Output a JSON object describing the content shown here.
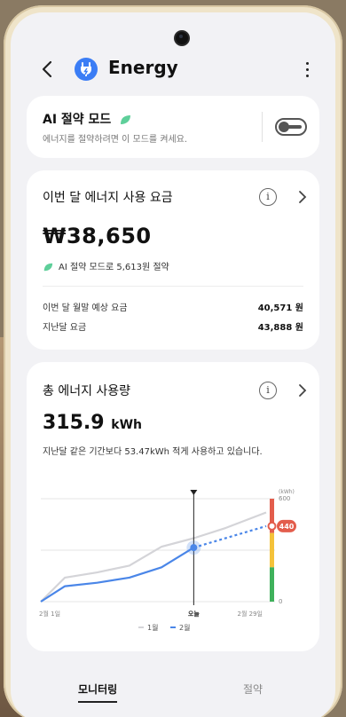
{
  "header": {
    "title": "Energy",
    "app_icon": "energy-plug-icon",
    "back_icon": "chevron-left-icon",
    "more_icon": "more-vertical-icon"
  },
  "ai_mode": {
    "title": "AI 절약 모드",
    "subtitle": "에너지를 절약하려면 이 모드를 켜세요.",
    "enabled": false
  },
  "bill": {
    "title": "이번 달 에너지 사용 요금",
    "amount": "₩38,650",
    "saving_text": "AI 절약 모드로 5,613원 절약",
    "rows": [
      {
        "label": "이번 달 월말 예상 요금",
        "value": "40,571 원"
      },
      {
        "label": "지난달 요금",
        "value": "43,888 원"
      }
    ]
  },
  "usage": {
    "title": "총 에너지 사용량",
    "value": "315.9",
    "unit": "kWh",
    "description": "지난달 같은 기간보다 53.47kWh 적게 사용하고 있습니다."
  },
  "chart_data": {
    "type": "line",
    "y_unit": "(kWh)",
    "y_ticks": [
      "600",
      "0"
    ],
    "x_ticks": [
      "2월 1일",
      "오늘",
      "2월 29일"
    ],
    "today_marker": "오늘",
    "forecast_label": "440",
    "ylim": [
      0,
      600
    ],
    "legend": [
      "1월",
      "2월"
    ],
    "series": [
      {
        "name": "1월",
        "color": "#d4d4d8",
        "points": [
          [
            1,
            0
          ],
          [
            4,
            140
          ],
          [
            8,
            170
          ],
          [
            12,
            210
          ],
          [
            16,
            320
          ],
          [
            20,
            370
          ],
          [
            24,
            430
          ],
          [
            29,
            520
          ]
        ]
      },
      {
        "name": "2월",
        "color": "#4a86e8",
        "points": [
          [
            1,
            0
          ],
          [
            4,
            90
          ],
          [
            8,
            110
          ],
          [
            12,
            140
          ],
          [
            16,
            200
          ],
          [
            20,
            315
          ]
        ]
      },
      {
        "name": "2월 예상",
        "color": "#4a86e8",
        "dashed": true,
        "points": [
          [
            20,
            315
          ],
          [
            29,
            440
          ]
        ]
      }
    ],
    "today_day": 20,
    "x_range": [
      1,
      29
    ],
    "gauge_colors": [
      "#e35d4c",
      "#f4c23a",
      "#3fb15b"
    ]
  },
  "bottom_nav": {
    "tabs": [
      {
        "label": "모니터링",
        "active": true
      },
      {
        "label": "절약",
        "active": false
      }
    ]
  },
  "colors": {
    "accent": "#3b7df5",
    "leaf": "#5ecf9a",
    "forecast": "#e35d4c"
  }
}
